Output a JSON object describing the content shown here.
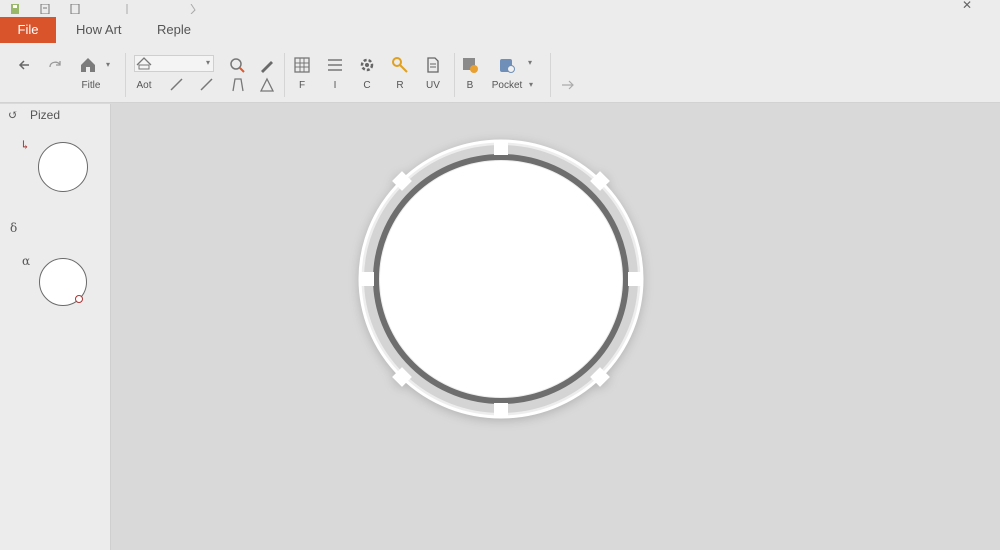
{
  "menu": {
    "file_label": "File",
    "tabs": [
      "How Art",
      "Reple"
    ]
  },
  "ribbon": {
    "labels": {
      "home": "Fitle",
      "font": "Aot",
      "format_f": "F",
      "format_i": "I",
      "format_c": "C",
      "format_r": "R",
      "format_uv": "UV",
      "insert_b": "B",
      "pocket": "Pocket"
    }
  },
  "left_panel": {
    "title": "Pized",
    "glyph_top": "↳",
    "glyph_mid": "δ",
    "glyph_low": "α"
  },
  "colors": {
    "accent": "#d9532b",
    "ribbon_bg": "#ececec",
    "canvas_bg": "#d9d9d9",
    "ring_dark": "#6e6e6e",
    "ring_light": "#d4d4d4"
  },
  "icons": [
    "undo-icon",
    "redo-icon",
    "home-icon",
    "shape-icon",
    "paint-fill-icon",
    "pencil-icon",
    "table-icon",
    "list-icon",
    "gear-icon",
    "key-icon",
    "document-icon",
    "image-insert-icon",
    "pocket-icon",
    "arrow-right-icon"
  ]
}
